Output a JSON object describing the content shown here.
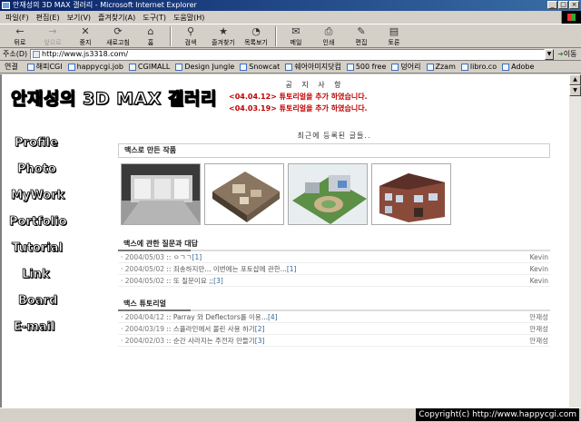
{
  "window": {
    "title": "안재성의 3D MAX 갤러리 - Microsoft Internet Explorer",
    "min": "_",
    "max": "□",
    "close": "×"
  },
  "menu": [
    "파일(F)",
    "편집(E)",
    "보기(V)",
    "즐겨찾기(A)",
    "도구(T)",
    "도움말(H)"
  ],
  "toolbar": [
    {
      "label": "뒤로",
      "icon": "back-icon",
      "glyph": "←"
    },
    {
      "label": "앞으로",
      "icon": "forward-icon",
      "glyph": "→"
    },
    {
      "label": "중지",
      "icon": "stop-icon",
      "glyph": "✕"
    },
    {
      "label": "새로고침",
      "icon": "refresh-icon",
      "glyph": "⟳"
    },
    {
      "label": "홈",
      "icon": "home-icon",
      "glyph": "⌂"
    },
    {
      "label": "검색",
      "icon": "search-icon",
      "glyph": "⚲"
    },
    {
      "label": "즐겨찾기",
      "icon": "favorites-icon",
      "glyph": "★"
    },
    {
      "label": "목록보기",
      "icon": "history-icon",
      "glyph": "◔"
    },
    {
      "label": "메일",
      "icon": "mail-icon",
      "glyph": "✉"
    },
    {
      "label": "인쇄",
      "icon": "print-icon",
      "glyph": "⎙"
    },
    {
      "label": "편집",
      "icon": "edit-icon",
      "glyph": "✎"
    },
    {
      "label": "토론",
      "icon": "discuss-icon",
      "glyph": "▤"
    }
  ],
  "address": {
    "label": "주소(D)",
    "url": "http://www.js3318.com/",
    "go": "이동"
  },
  "links": {
    "label": "연결",
    "items": [
      "해피CGI",
      "happycgi.job",
      "CGIMALL",
      "Design Jungle",
      "Snowcat",
      "쉐어아미지닷컴",
      "500 free",
      "덩어리",
      "Zzam",
      "libro.co",
      "Adobe"
    ]
  },
  "page": {
    "logo": "안재성의 3D MAX 갤러리",
    "notice": {
      "title": "공 지 사 항",
      "lines": [
        "<04.04.12> 튜토리얼을 추가 하였습니다.",
        "<04.03.19> 튜토리얼을 추가 하였습니다."
      ]
    },
    "nav": [
      "Profile",
      "Photo",
      "MyWork",
      "Portfolio",
      "Tutorial",
      "Link",
      "Board",
      "E-mail"
    ],
    "recent_title": "최근에 등록된 글들..",
    "works_title": "맥스로 만든 작품",
    "qa": {
      "title": "맥스에 관한 질문과 대답",
      "rows": [
        {
          "date": "2004/05/03",
          "text": "ㅇㄱㄱ",
          "count": "[1]",
          "author": "Kevin"
        },
        {
          "date": "2004/05/02",
          "text": "죄송하지만... 이번에는 포토샵에 관한...",
          "count": "[1]",
          "author": "Kevin"
        },
        {
          "date": "2004/05/02",
          "text": "또 질문이요 ;;",
          "count": "[3]",
          "author": "Kevin"
        }
      ]
    },
    "tutorial": {
      "title": "맥스 튜토리얼",
      "rows": [
        {
          "date": "2004/04/12",
          "text": "Parray 와 Deflectors를 이용...",
          "count": "[4]",
          "author": "안재성"
        },
        {
          "date": "2004/03/19",
          "text": "스플라인에서 볼린 사용 하기",
          "count": "[2]",
          "author": "안재성"
        },
        {
          "date": "2004/02/03",
          "text": "순간 사라지는 주전자 만들기",
          "count": "[3]",
          "author": "안재성"
        }
      ]
    }
  },
  "status": {
    "copyright": "Copyright(c) http://www.happycgi.com"
  }
}
